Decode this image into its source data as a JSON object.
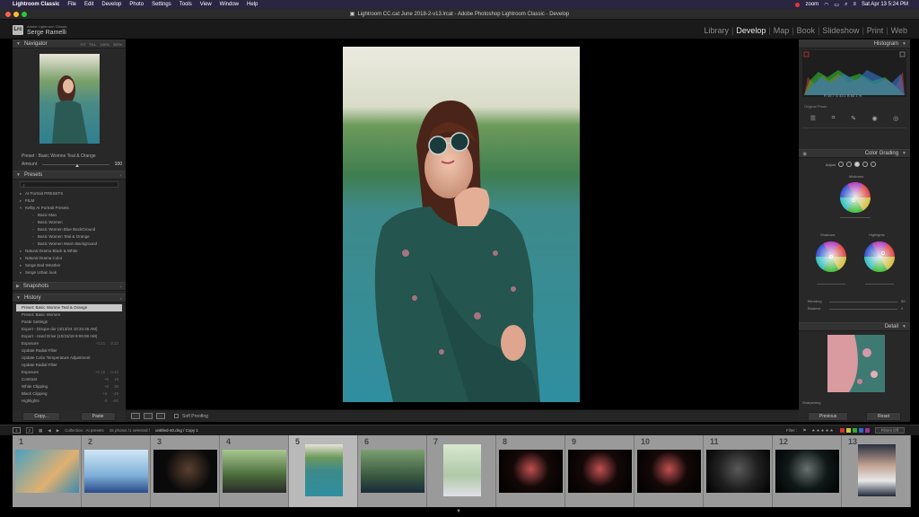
{
  "menubar": {
    "app": "Lightroom Classic",
    "items": [
      "File",
      "Edit",
      "Develop",
      "Photo",
      "Settings",
      "Tools",
      "View",
      "Window",
      "Help"
    ],
    "zoom": "zoom",
    "clock": "Sat Apr 13  5:24 PM"
  },
  "window": {
    "title": "Lightroom CC.cat June 2018-2-v13.lrcat - Adobe Photoshop Lightroom Classic - Develop"
  },
  "header": {
    "logo": "Lrc",
    "brand_top": "Adobe Lightroom Classic",
    "brand_user": "Serge Ramelli",
    "modules": [
      "Library",
      "Develop",
      "Map",
      "Book",
      "Slideshow",
      "Print",
      "Web"
    ],
    "active_module": "Develop"
  },
  "left": {
    "navigator": {
      "title": "Navigator",
      "zoom_opts": [
        "FIT",
        "FILL",
        "100%",
        "300%"
      ]
    },
    "preset_label": "Preset : Basic Womne Teal & Orange",
    "amount_label": "Amount",
    "amount_value": "100",
    "presets_title": "Presets",
    "presets": [
      {
        "label": "AI Portrait PRESETS",
        "arrow": "▸",
        "sub": false
      },
      {
        "label": "FILM",
        "arrow": "▸",
        "sub": false
      },
      {
        "label": "Kelby AI Portrait Presets",
        "arrow": "▾",
        "sub": false
      },
      {
        "label": "Basic Man",
        "arrow": "",
        "sub": true
      },
      {
        "label": "Basic Women",
        "arrow": "",
        "sub": true
      },
      {
        "label": "Basic Women Blue BackGround",
        "arrow": "",
        "sub": true
      },
      {
        "label": "Basic Women Teal & Orange",
        "arrow": "",
        "sub": true
      },
      {
        "label": "Basic Women Warm Background",
        "arrow": "",
        "sub": true
      },
      {
        "label": "Natural Drama Black & White",
        "arrow": "▸",
        "sub": false
      },
      {
        "label": "Natural Drama Color",
        "arrow": "▸",
        "sub": false
      },
      {
        "label": "Serge Bad Weather",
        "arrow": "▸",
        "sub": false
      },
      {
        "label": "Serge Urban look",
        "arrow": "▸",
        "sub": false
      }
    ],
    "snapshots_title": "Snapshots",
    "history_title": "History",
    "history": [
      {
        "label": "Preset: Basic Womne Teal & Orange",
        "a": "",
        "b": "",
        "sel": true
      },
      {
        "label": "Preset: Basic Women",
        "a": "",
        "b": "",
        "sel": false
      },
      {
        "label": "Paste Settings",
        "a": "",
        "b": "",
        "sel": false
      },
      {
        "label": "Export - Disque dur (4/13/24 10:34:46 AM)",
        "a": "",
        "b": "",
        "sel": false
      },
      {
        "label": "Export - Hard Drive (10/23/19 9:09:08 AM)",
        "a": "",
        "b": "",
        "sel": false
      },
      {
        "label": "Exposure",
        "a": "-0.21",
        "b": "0.22",
        "sel": false
      },
      {
        "label": "Update Radial Filter",
        "a": "",
        "b": "",
        "sel": false
      },
      {
        "label": "Update Color Temperature Adjustment",
        "a": "",
        "b": "",
        "sel": false
      },
      {
        "label": "Update Radial Filter",
        "a": "",
        "b": "",
        "sel": false
      },
      {
        "label": "Exposure",
        "a": "+0.15",
        "b": "0.43",
        "sel": false
      },
      {
        "label": "Contrast",
        "a": "+6",
        "b": "18",
        "sel": false
      },
      {
        "label": "White Clipping",
        "a": "+6",
        "b": "35",
        "sel": false
      },
      {
        "label": "Black Clipping",
        "a": "+6",
        "b": "-45",
        "sel": false
      },
      {
        "label": "Highlights",
        "a": "-5",
        "b": "-60",
        "sel": false
      }
    ],
    "copy": "Copy...",
    "paste": "Paste"
  },
  "toolbar": {
    "soft_proofing": "Soft Proofing"
  },
  "right": {
    "histogram_title": "Histogram",
    "hist_vals": "R  49.7   G  43.1   B  60.1 %",
    "original_photo": "Original Photo",
    "color_grading_title": "Color Grading",
    "adjust_label": "Adjust",
    "midtones": "Midtones",
    "shadows": "Shadows",
    "highlights": "Highlights",
    "blending": "Blending",
    "blending_val": "50",
    "balance": "Balance",
    "balance_val": "0",
    "detail_title": "Detail",
    "sharpening": "Sharpening",
    "previous": "Previous",
    "reset": "Reset"
  },
  "filmbar": {
    "pages": [
      "1",
      "2"
    ],
    "collection": "Collection : AI presets",
    "count": "15 photos /1 selected /",
    "file": "untitled-40.dng / Copy 1",
    "filter": "Filter :",
    "filters_off": "Filters Off"
  },
  "filmstrip": {
    "cells": [
      "1",
      "2",
      "3",
      "4",
      "5",
      "6",
      "7",
      "8",
      "9",
      "10",
      "11",
      "12",
      "13"
    ],
    "selected": 4
  },
  "colors": {
    "accent": "#e8e8e8",
    "panel": "#282828",
    "menubar": "#2a2540"
  }
}
